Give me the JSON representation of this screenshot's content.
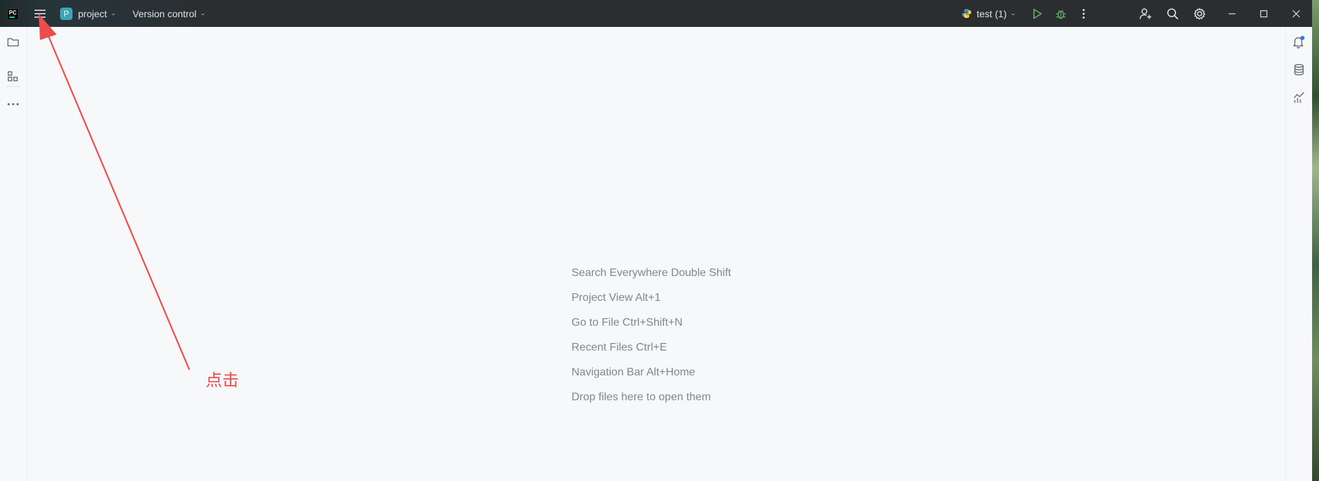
{
  "titlebar": {
    "logo_text": "PC",
    "project_badge": "P",
    "project_name": "project",
    "vcs_label": "Version control",
    "run_config": "test (1)",
    "icons": [
      "main-menu-icon",
      "run-icon",
      "debug-icon",
      "more-vertical-icon",
      "add-user-icon",
      "search-icon",
      "gear-icon",
      "minimize-icon",
      "maximize-icon",
      "close-icon"
    ]
  },
  "left_toolbar": {
    "icons": [
      "folder-icon",
      "structure-icon",
      "more-horizontal-icon"
    ]
  },
  "right_toolbar": {
    "icons": [
      "notifications-icon",
      "database-icon",
      "profiler-icon"
    ]
  },
  "empty_editor": {
    "hints": [
      "Search Everywhere Double Shift",
      "Project View Alt+1",
      "Go to File Ctrl+Shift+N",
      "Recent Files Ctrl+E",
      "Navigation Bar Alt+Home",
      "Drop files here to open them"
    ]
  },
  "annotation": {
    "text": "点击",
    "color": "#f04b4b"
  },
  "colors": {
    "titlebar": "#2b2d30",
    "editor_bg": "#f7f8fa",
    "run_green": "#5fb865",
    "hint_text": "#818594",
    "notification_dot": "#3574f0"
  }
}
